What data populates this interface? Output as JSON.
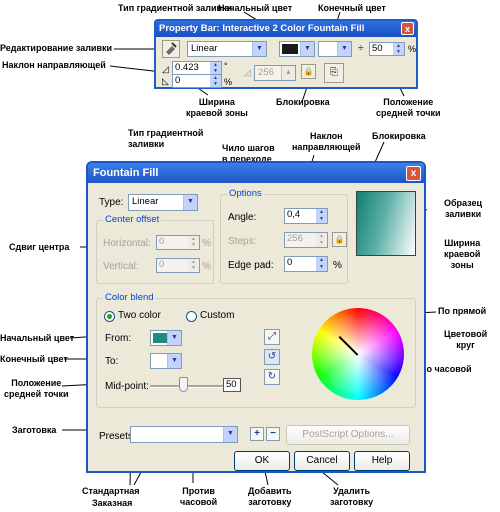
{
  "annotations": {
    "fill_type": "Тип градиентной\nзаливки",
    "start_color": "Начальный цвет",
    "end_color": "Конечный цвет",
    "edit_fill": "Редактирование заливки",
    "guide_slope": "Наклон направляющей",
    "edge_width": "Ширина\nкраевой зоны",
    "lock": "Блокировка",
    "midpoint": "Положение\nсредней точки",
    "fill_type2": "Тип градиентной\nзаливки",
    "steps": "Чило шагов\nв переходе",
    "guide_slope2": "Наклон\nнаправляющей",
    "lock2": "Блокировка",
    "sample": "Образец\nзаливки",
    "center_shift": "Сдвиг центра",
    "edge_width2": "Ширина\nкраевой\nзоны",
    "linear_path": "По прямой",
    "color_wheel": "Цветовой\nкруг",
    "clockwise": "По часовой",
    "start_color2": "Начальный цвет",
    "end_color2": "Конечный цвет",
    "midpoint2": "Положение\nсредней точки",
    "preset": "Заготовка",
    "standard": "Стандартная",
    "custom": "Заказная",
    "ccw": "Против\nчасовой",
    "add_preset": "Добавить\nзаготовку",
    "del_preset": "Удалить\nзаготовку"
  },
  "property_bar": {
    "title": "Property Bar: Interactive 2 Color Fountain Fill",
    "close": "x",
    "fill_type": "Linear",
    "angle": "0.423",
    "edge": "0",
    "steps": "256",
    "midpoint": "50",
    "percent": "%",
    "degree": "°",
    "start_color": "#1A1A1A",
    "end_color": "#FFFFFF"
  },
  "dialog": {
    "title": "Fountain Fill",
    "close": "x",
    "type_label": "Type:",
    "type_value": "Linear",
    "center_offset": "Center offset",
    "horizontal": "Horizontal:",
    "horizontal_value": "0",
    "vertical": "Vertical:",
    "vertical_value": "0",
    "percent": "%",
    "options": "Options",
    "angle_label": "Angle:",
    "angle_value": "0,4",
    "steps_label": "Steps:",
    "steps_value": "256",
    "edge_pad_label": "Edge pad:",
    "edge_pad_value": "0",
    "color_blend": "Color blend",
    "two_color": "Two color",
    "custom": "Custom",
    "from_label": "From:",
    "to_label": "To:",
    "midpoint_label": "Mid-point:",
    "midpoint_value": "50",
    "from_color": "#1E8C82",
    "to_color": "#FFFFFF",
    "presets_label": "Presets:",
    "presets_value": "",
    "postscript": "PostScript Options...",
    "ok": "OK",
    "cancel": "Cancel",
    "help": "Help"
  }
}
